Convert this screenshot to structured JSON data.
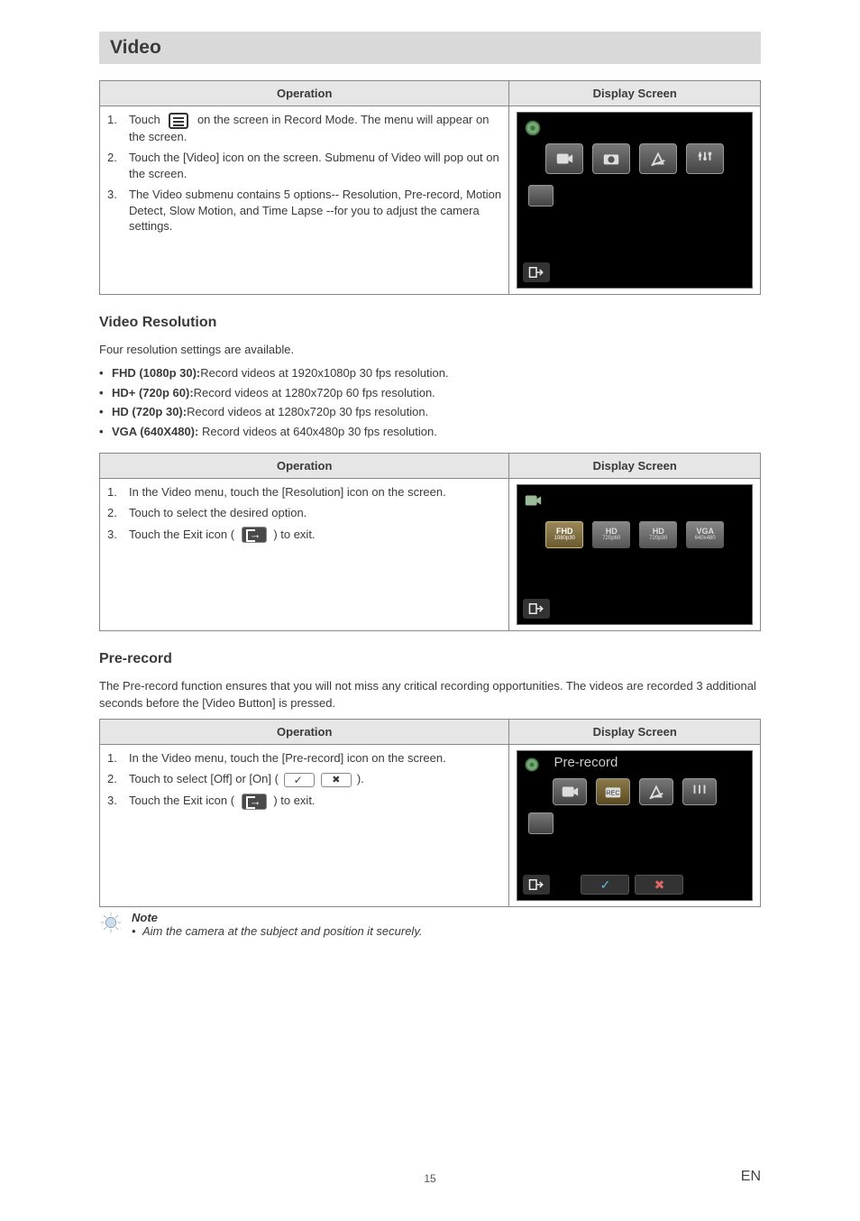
{
  "title": "Video",
  "table1": {
    "head_op": "Operation",
    "head_ds": "Display Screen",
    "items": [
      {
        "n": "1.",
        "pre": "Touch",
        "post": "on the screen in Record Mode. The menu will appear on the screen."
      },
      {
        "n": "2.",
        "text": "Touch the [Video] icon on the screen. Submenu of Video will pop out on the screen."
      },
      {
        "n": "3.",
        "text": "The Video submenu contains 5 options-- Resolution, Pre-record, Motion Detect, Slow Motion, and Time Lapse --for you to adjust the camera settings."
      }
    ]
  },
  "res": {
    "heading": "Video Resolution",
    "intro": "Four resolution settings are available.",
    "bullets": [
      {
        "b": "FHD (1080p 30):",
        "t": "Record videos at 1920x1080p 30 fps resolution."
      },
      {
        "b": "HD+ (720p 60):",
        "t": "Record videos at 1280x720p 60 fps resolution."
      },
      {
        "b": "HD (720p 30):",
        "t": "Record videos at 1280x720p 30 fps resolution."
      },
      {
        "b": "VGA (640X480):",
        "t": " Record videos at 640x480p 30 fps resolution."
      }
    ],
    "ds_chips": [
      {
        "l1": "FHD",
        "l2": "1080p30"
      },
      {
        "l1": "HD",
        "l2": "720p60"
      },
      {
        "l1": "HD",
        "l2": "720p30"
      },
      {
        "l1": "VGA",
        "l2": "640x480"
      }
    ]
  },
  "table2": {
    "head_op": "Operation",
    "head_ds": "Display Screen",
    "items": [
      {
        "n": "1.",
        "text": "In the Video menu, touch the [Resolution] icon on the screen."
      },
      {
        "n": "2.",
        "text": "Touch to select the desired option."
      },
      {
        "n": "3.",
        "pre": "Touch the Exit icon (",
        "post": ") to exit."
      }
    ]
  },
  "pre": {
    "heading": "Pre-record",
    "intro": "The Pre-record function ensures that you will not miss any critical recording opportunities. The videos are recorded 3 additional seconds before the [Video Button] is pressed.",
    "ds_title": "Pre-record"
  },
  "table3": {
    "head_op": "Operation",
    "head_ds": "Display Screen",
    "items": [
      {
        "n": "1.",
        "text": "In the Video menu, touch the [Pre-record] icon on the screen."
      },
      {
        "n": "2.",
        "pre": "Touch to select [Off] or [On] (",
        "post": ")."
      },
      {
        "n": "3.",
        "pre": "Touch the Exit icon (",
        "post": ") to exit."
      }
    ]
  },
  "note": {
    "title": "Note",
    "line": "Aim the camera at the subject and position it securely."
  },
  "footer": {
    "page": "15",
    "lang": "EN"
  }
}
